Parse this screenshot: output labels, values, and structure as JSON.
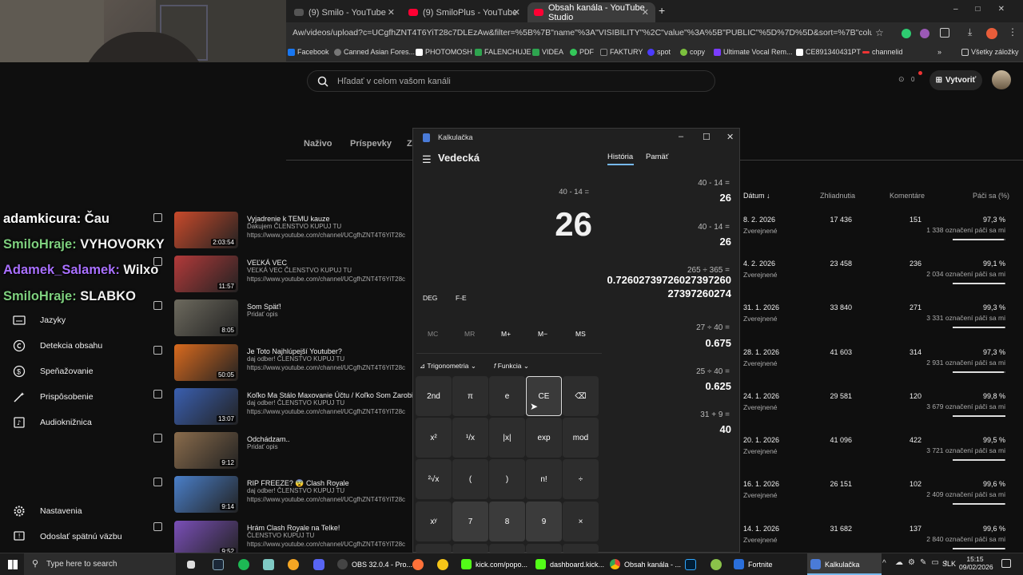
{
  "browser": {
    "tabs": [
      {
        "label": "(9) Smilo - YouTube"
      },
      {
        "label": "(9) SmiloPlus - YouTube"
      },
      {
        "label": "Obsah kanála - YouTube Studio"
      }
    ],
    "url": "Aw/videos/upload?c=UCgfhZNT4T6YiT28c7DLEzAw&filter=%5B%7B\"name\"%3A\"VISIBILITY\"%2C\"value\"%3A%5B\"PUBLIC\"%5D%7D%5D&sort=%7B\"columnType\"%3A\"date\"%2...",
    "bookmarks": [
      "Facebook",
      "Canned Asian Fores...",
      "PHOTOMOSH",
      "FALENCHUJE",
      "VIDEA",
      "PDF",
      "FAKTURY",
      "spot",
      "copy",
      "Ultimate Vocal Rem...",
      "CE891340431PT",
      "channelid"
    ],
    "all_bookmarks": "Všetky záložky"
  },
  "studio": {
    "search_placeholder": "Hľadať v celom vašom kanáli",
    "notif_count": "0",
    "create_label": "Vytvoriť",
    "tabs": [
      "Naživo",
      "Príspevky",
      "Z"
    ],
    "columns": {
      "date": "Dátum",
      "views": "Zhliadnutia",
      "comments": "Komentáre",
      "likes": "Páči sa (%)"
    },
    "sidebar": [
      "Jazyky",
      "Detekcia obsahu",
      "Speňažovanie",
      "Prispôsobenie",
      "Audioknižnica",
      "Nastavenia",
      "Odoslať spätnú väzbu"
    ],
    "videos": [
      {
        "title": "Vyjadrenie k TEMU kauze",
        "desc": "Ďakujem ČLENSTVO KUPUJ TU",
        "url": "https://www.youtube.com/channel/UCgfhZNT4T6YiT28c",
        "duration": "2:03:54",
        "date": "8. 2. 2026",
        "vis": "Zverejnené",
        "views": "17 436",
        "comments": "151",
        "likes": "97,3 %",
        "likes_count": "1 338 označení páči sa mi",
        "pct": 0.973,
        "thumb": "#c94a2b"
      },
      {
        "title": "VEĽKÁ VEC",
        "desc": "VEĽKÁ VEC ČLENSTVO KUPUJ TU",
        "url": "https://www.youtube.com/channel/UCgfhZNT4T6YiT28c",
        "duration": "11:57",
        "date": "4. 2. 2026",
        "vis": "Zverejnené",
        "views": "23 458",
        "comments": "236",
        "likes": "99,1 %",
        "likes_count": "2 034 označení páči sa mi",
        "pct": 0.991,
        "thumb": "#b33a3a"
      },
      {
        "title": "Som Späť!",
        "desc": "Pridať opis",
        "url": "",
        "duration": "8:05",
        "date": "31. 1. 2026",
        "vis": "Zverejnené",
        "views": "33 840",
        "comments": "271",
        "likes": "99,3 %",
        "likes_count": "3 331 označení páči sa mi",
        "pct": 0.993,
        "thumb": "#6d6a5e"
      },
      {
        "title": "Je Toto Najhlúpejší Youtuber?",
        "desc": "daj odber! ČLENSTVO KUPUJ TU",
        "url": "https://www.youtube.com/channel/UCgfhZNT4T6YiT28c",
        "duration": "50:05",
        "date": "28. 1. 2026",
        "vis": "Zverejnené",
        "views": "41 603",
        "comments": "314",
        "likes": "97,3 %",
        "likes_count": "2 931 označení páči sa mi",
        "pct": 0.973,
        "thumb": "#d96a1e"
      },
      {
        "title": "Koľko Ma Stálo Maxovanie Účtu / Koľko Som Zarobil z",
        "desc": "daj odber! ČLENSTVO KUPUJ TU",
        "url": "https://www.youtube.com/channel/UCgfhZNT4T6YiT28c",
        "duration": "13:07",
        "date": "24. 1. 2026",
        "vis": "Zverejnené",
        "views": "29 581",
        "comments": "120",
        "likes": "99,8 %",
        "likes_count": "3 679 označení páči sa mi",
        "pct": 0.998,
        "thumb": "#3a5fb0"
      },
      {
        "title": "Odchádzam..",
        "desc": "Pridať opis",
        "url": "",
        "duration": "9:12",
        "date": "20. 1. 2026",
        "vis": "Zverejnené",
        "views": "41 096",
        "comments": "422",
        "likes": "99,5 %",
        "likes_count": "3 721 označení páči sa mi",
        "pct": 0.995,
        "thumb": "#8a6c4c"
      },
      {
        "title": "RIP FREEZE? 😨 Clash Royale",
        "desc": "daj odber! ČLENSTVO KUPUJ TU",
        "url": "https://www.youtube.com/channel/UCgfhZNT4T6YiT28c",
        "duration": "9:14",
        "date": "16. 1. 2026",
        "vis": "Zverejnené",
        "views": "26 151",
        "comments": "102",
        "likes": "99,6 %",
        "likes_count": "2 409 označení páči sa mi",
        "pct": 0.996,
        "thumb": "#4a7fc9"
      },
      {
        "title": "Hrám Clash Royale na Telke!",
        "desc": "ČLENSTVO KUPUJ TU",
        "url": "https://www.youtube.com/channel/UCgfhZNT4T6YiT28c",
        "duration": "9:52",
        "date": "14. 1. 2026",
        "vis": "Zverejnené",
        "views": "31 682",
        "comments": "137",
        "likes": "99,6 %",
        "likes_count": "2 840 označení páči sa mi",
        "pct": 0.996,
        "thumb": "#7a4fb8"
      }
    ]
  },
  "chat": [
    {
      "user": "adamkicura:",
      "msg": " Čau",
      "color": "#ffffff"
    },
    {
      "user": "SmiloHraje:",
      "msg": " VYHOVORKY",
      "color": "#7ed07e"
    },
    {
      "user": "Adamek_Salamek:",
      "msg": " Wilxo",
      "color": "#a970ff"
    },
    {
      "user": "SmiloHraje:",
      "msg": " SLABKO",
      "color": "#7ed07e"
    }
  ],
  "calculator": {
    "window_title": "Kalkulačka",
    "mode": "Vedecká",
    "history_tab": "História",
    "memory_tab": "Pamäť",
    "expression": "40 - 14 =",
    "display": "26",
    "deg": "DEG",
    "fe": "F-E",
    "memory_keys": [
      "MC",
      "MR",
      "M+",
      "M−",
      "MS"
    ],
    "trig": "Trigonometria",
    "func": "Funkcia",
    "keys": [
      [
        "2nd",
        "π",
        "e",
        "CE",
        "⌫"
      ],
      [
        "x²",
        "¹/x",
        "|x|",
        "exp",
        "mod"
      ],
      [
        "²√x",
        "(",
        ")",
        "n!",
        "÷"
      ],
      [
        "xʸ",
        "7",
        "8",
        "9",
        "×"
      ]
    ],
    "history": [
      {
        "expr": "40  -  14 =",
        "result": "26"
      },
      {
        "expr": "40  -  14 =",
        "result": "26"
      },
      {
        "expr": "265  ÷  365 =",
        "result": "0.7260273972602739726027397260274"
      },
      {
        "expr": "27  ÷  40 =",
        "result": "0.675"
      },
      {
        "expr": "25  ÷  40 =",
        "result": "0.625"
      },
      {
        "expr": "31  +  9 =",
        "result": "40"
      }
    ]
  },
  "taskbar": {
    "search": "Type here to search",
    "apps": [
      "OBS 32.0.4 - Pro...",
      "kick.com/popo...",
      "dashboard.kick...",
      "Obsah kanála - ...",
      "Fortnite",
      "Kalkulačka"
    ],
    "lang": "SLK",
    "time": "15:15",
    "date": "09/02/2026"
  }
}
